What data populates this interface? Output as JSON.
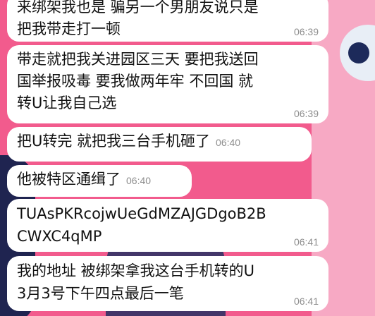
{
  "messages": [
    {
      "text": "来绑架我也是 骗另一个男朋友说只是\n把我带走打一顿",
      "time": "06:39"
    },
    {
      "text": "带走就把我关进园区三天 要把我送回\n国举报吸毒 要我做两年牢 不回国 就\n转U让我自己选",
      "time": "06:39"
    },
    {
      "text": "把U转完 就把我三台手机砸了",
      "time": "06:40"
    },
    {
      "text": "他被特区通缉了",
      "time": "06:40"
    },
    {
      "text": "TUAsPKRcojwUeGdMZAJGDgoB2B\nCWXC4qMP",
      "time": "06:41"
    },
    {
      "text": "我的地址 被绑架拿我这台手机转的U\n3月3号下午四点最后一笔",
      "time": "06:41"
    }
  ],
  "wallpaper": {
    "background": "#f25b8d",
    "bubble_color": "#ffffff"
  }
}
